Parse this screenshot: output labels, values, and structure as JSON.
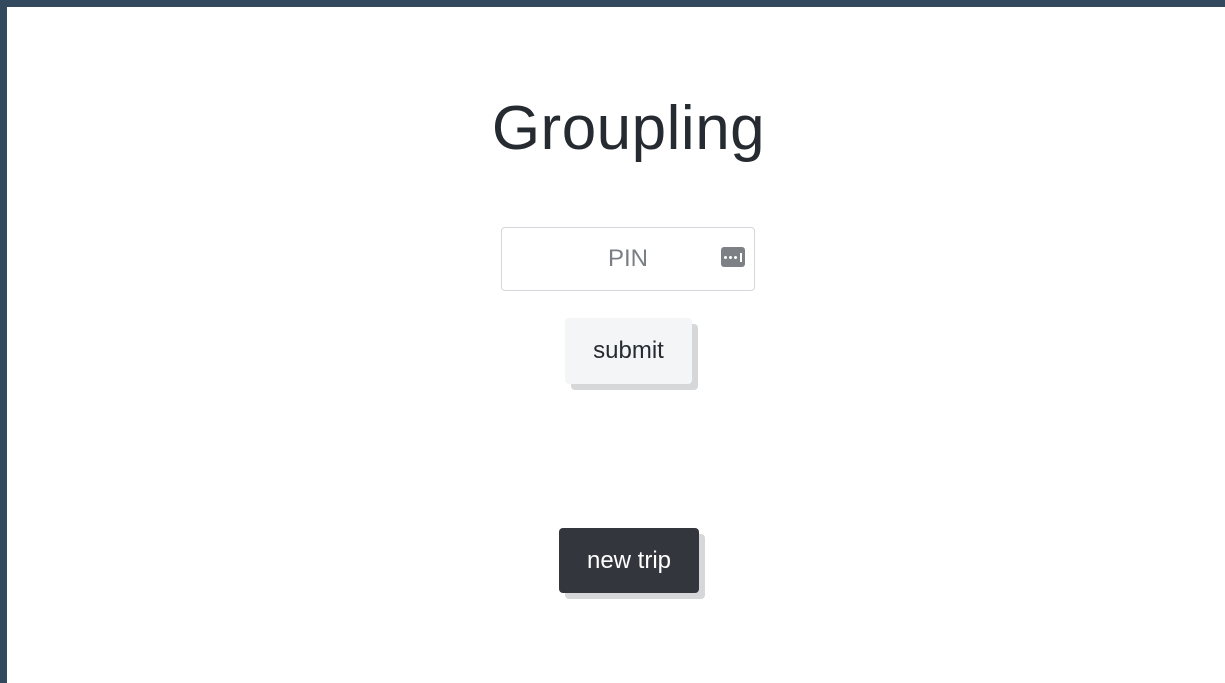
{
  "app": {
    "title": "Groupling"
  },
  "pin_form": {
    "pin_placeholder": "PIN",
    "pin_value": "",
    "password_manager_icon": "password-key-icon",
    "submit_label": "submit"
  },
  "actions": {
    "new_trip_label": "new trip"
  },
  "colors": {
    "background": "#ffffff",
    "outer_frame": "#33495e",
    "title_text": "#262b31",
    "submit_button_bg": "#f4f5f7",
    "new_trip_button_bg": "#33363d",
    "button_shadow": "#d6d7d9"
  }
}
